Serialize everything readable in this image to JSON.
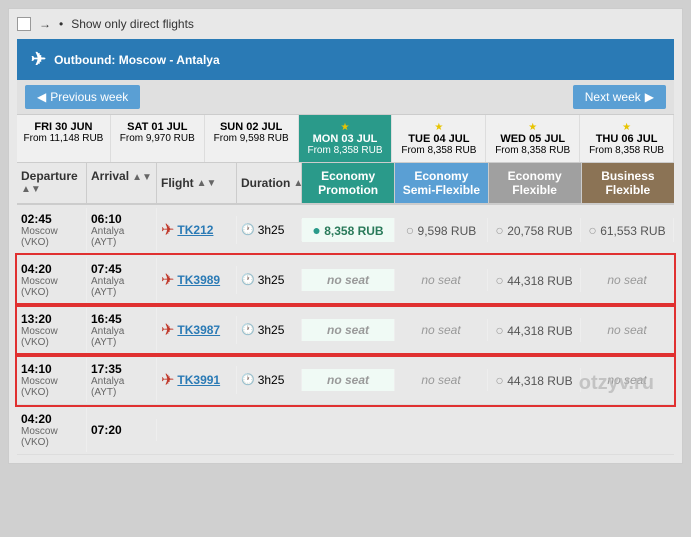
{
  "topbar": {
    "checkbox_label": "",
    "show_direct": "Show only direct flights"
  },
  "header": {
    "title": "Outbound: Moscow - Antalya"
  },
  "nav": {
    "prev_label": "Previous week",
    "next_label": "Next week"
  },
  "dates": [
    {
      "day": "FRI 30 JUN",
      "price": "From 11,148 RUB",
      "active": false,
      "star": false
    },
    {
      "day": "SAT 01 JUL",
      "price": "From 9,970 RUB",
      "active": false,
      "star": false
    },
    {
      "day": "SUN 02 JUL",
      "price": "From 9,598 RUB",
      "active": false,
      "star": false
    },
    {
      "day": "MON 03 JUL",
      "price": "From 8,358 RUB",
      "active": true,
      "star": true
    },
    {
      "day": "TUE 04 JUL",
      "price": "From 8,358 RUB",
      "active": false,
      "star": true
    },
    {
      "day": "WED 05 JUL",
      "price": "From 8,358 RUB",
      "active": false,
      "star": true
    },
    {
      "day": "THU 06 JUL",
      "price": "From 8,358 RUB",
      "active": false,
      "star": true
    }
  ],
  "columns": {
    "departure": "Departure",
    "arrival": "Arrival",
    "flight": "Flight",
    "duration": "Duration",
    "econ_promo": "Economy Promotion",
    "econ_semi": "Economy Semi-Flexible",
    "econ_flex": "Economy Flexible",
    "biz": "Business Flexible"
  },
  "rows": [
    {
      "dep_time": "02:45",
      "dep_city": "Moscow (VKO)",
      "arr_time": "06:10",
      "arr_city": "Antalya (AYT)",
      "flight": "TK212",
      "duration": "3h25",
      "econ_promo": "8,358 RUB",
      "econ_promo_selected": true,
      "econ_semi": "9,598 RUB",
      "econ_flex": "20,758 RUB",
      "biz": "61,553 RUB",
      "highlighted": false
    },
    {
      "dep_time": "04:20",
      "dep_city": "Moscow (VKO)",
      "arr_time": "07:45",
      "arr_city": "Antalya (AYT)",
      "flight": "TK3989",
      "duration": "3h25",
      "econ_promo": "no seat",
      "econ_promo_selected": false,
      "econ_semi": "no seat",
      "econ_flex": "44,318 RUB",
      "biz": "no seat",
      "highlighted": true
    },
    {
      "dep_time": "13:20",
      "dep_city": "Moscow (VKO)",
      "arr_time": "16:45",
      "arr_city": "Antalya (AYT)",
      "flight": "TK3987",
      "duration": "3h25",
      "econ_promo": "no seat",
      "econ_promo_selected": false,
      "econ_semi": "no seat",
      "econ_flex": "44,318 RUB",
      "biz": "no seat",
      "highlighted": true
    },
    {
      "dep_time": "14:10",
      "dep_city": "Moscow (VKO)",
      "arr_time": "17:35",
      "arr_city": "Antalya (AYT)",
      "flight": "TK3991",
      "duration": "3h25",
      "econ_promo": "no seat",
      "econ_promo_selected": false,
      "econ_semi": "no seat",
      "econ_flex": "44,318 RUB",
      "biz": "no seat",
      "highlighted": true
    },
    {
      "dep_time": "04:20",
      "dep_city": "Moscow (VKO)",
      "arr_time": "07:20",
      "arr_city": "",
      "flight": "",
      "duration": "",
      "econ_promo": "",
      "econ_promo_selected": false,
      "econ_semi": "",
      "econ_flex": "",
      "biz": "",
      "highlighted": false,
      "partial": true
    }
  ],
  "watermark": "otzyv.ru"
}
